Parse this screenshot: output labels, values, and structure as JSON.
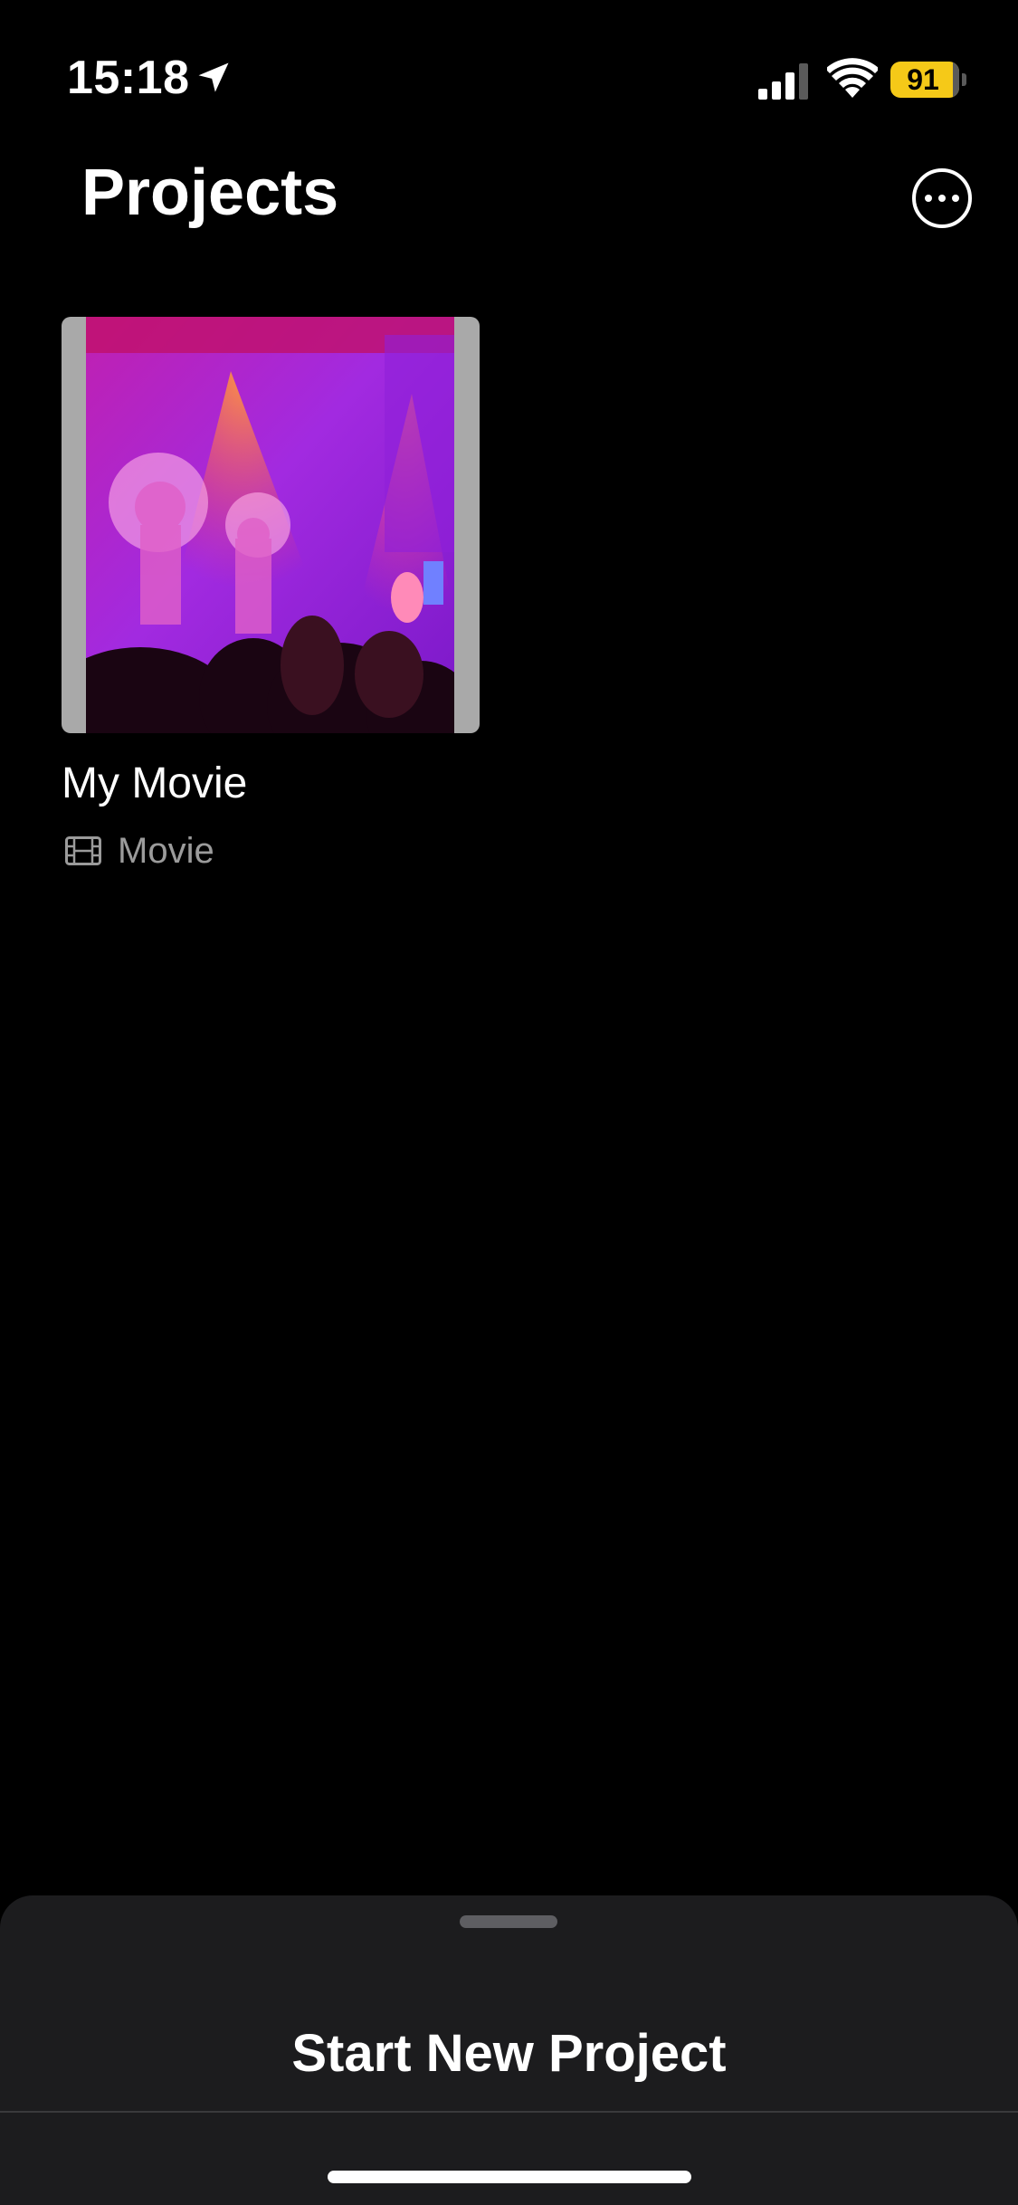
{
  "status_bar": {
    "time": "15:18",
    "battery_level": "91",
    "battery_color": "#f5c918",
    "icons": [
      "location-arrow-icon",
      "cellular-signal-icon",
      "wifi-icon",
      "battery-icon"
    ]
  },
  "header": {
    "title": "Projects",
    "more_icon": "ellipsis-circle-icon"
  },
  "projects": [
    {
      "name": "My Movie",
      "type": "Movie",
      "type_icon": "film-icon"
    }
  ],
  "bottom_sheet": {
    "start_label": "Start New Project"
  }
}
